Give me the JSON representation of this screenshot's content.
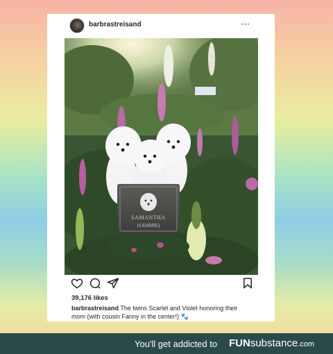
{
  "post": {
    "username": "barbrastreisand",
    "more_icon": "⋯",
    "likes": "39,176 likes",
    "caption_user": "barbrastreisand",
    "caption_text": " The twins Scarlet and Violet honoring their mom (with cousin Fanny in the center!) 🐾"
  },
  "photo": {
    "plaque_line1": "SAMANTHA",
    "plaque_line2": "(SAMMIE)"
  },
  "footer": {
    "tagline": "You'll get addicted to",
    "brand_bold": "FUN",
    "brand_regular": "substance",
    "brand_domain": ".com"
  },
  "colors": {
    "footer_bg": "#2a4a49",
    "text": "#262626"
  },
  "icons": [
    "heart-icon",
    "comment-icon",
    "share-icon",
    "bookmark-icon",
    "more-options-icon"
  ]
}
